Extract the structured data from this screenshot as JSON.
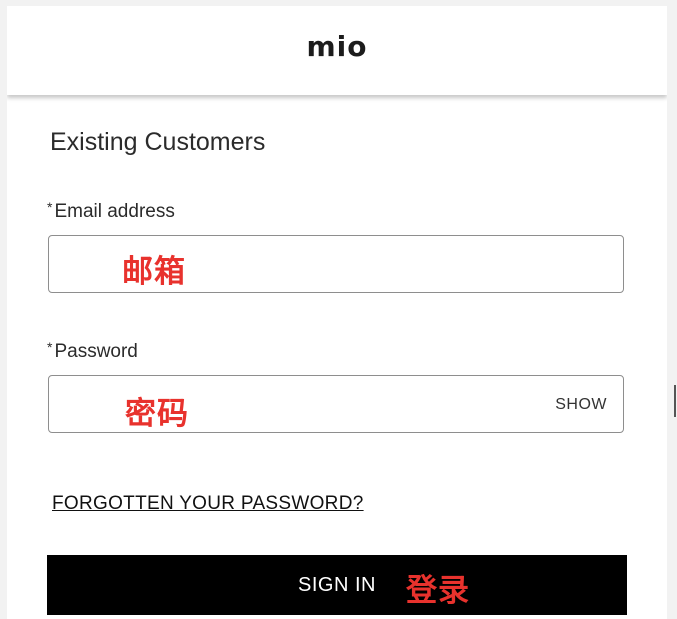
{
  "header": {
    "logo_text": "mio"
  },
  "login": {
    "title": "Existing Customers",
    "email": {
      "required_mark": "*",
      "label": "Email address",
      "annotation": "邮箱"
    },
    "password": {
      "required_mark": "*",
      "label": "Password",
      "annotation": "密码",
      "toggle_label": "SHOW"
    },
    "forgot_link": "FORGOTTEN YOUR PASSWORD?",
    "submit": {
      "label": "SIGN IN",
      "annotation": "登录"
    }
  },
  "colors": {
    "annotation": "#e8322d",
    "button_bg": "#000000",
    "border": "#8e8e8e"
  }
}
